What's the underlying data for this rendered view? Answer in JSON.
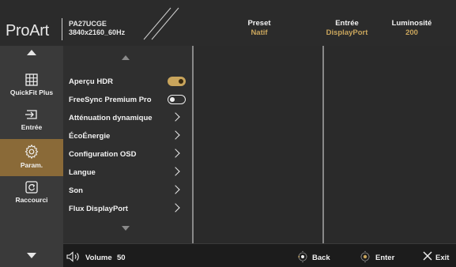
{
  "header": {
    "logo": "ProArt",
    "model": "PA27UCGE",
    "resolution": "3840x2160_60Hz",
    "preset": {
      "label": "Preset",
      "value": "Natif"
    },
    "input": {
      "label": "Entrée",
      "value": "DisplayPort"
    },
    "brightness": {
      "label": "Luminosité",
      "value": "200"
    }
  },
  "nav": {
    "items": [
      {
        "label": "QuickFit Plus",
        "icon": "grid-icon"
      },
      {
        "label": "Entrée",
        "icon": "input-icon"
      },
      {
        "label": "Param.",
        "icon": "gear-icon",
        "active": true
      },
      {
        "label": "Raccourci",
        "icon": "shortcut-icon"
      }
    ]
  },
  "menu": {
    "items": [
      {
        "label": "Aperçu HDR",
        "control": "toggle-on"
      },
      {
        "label": "FreeSync Premium Pro",
        "control": "toggle-off"
      },
      {
        "label": "Atténuation dynamique",
        "control": "chevron"
      },
      {
        "label": "ÉcoÉnergie",
        "control": "chevron"
      },
      {
        "label": "Configuration OSD",
        "control": "chevron"
      },
      {
        "label": "Langue",
        "control": "chevron"
      },
      {
        "label": "Son",
        "control": "chevron"
      },
      {
        "label": "Flux DisplayPort",
        "control": "chevron"
      }
    ]
  },
  "footer": {
    "volume_label": "Volume",
    "volume_value": "50",
    "back_label": "Back",
    "enter_label": "Enter",
    "exit_label": "Exit"
  },
  "colors": {
    "accent": "#c9a55c",
    "active_nav": "#8a6a38",
    "background": "#1e1e1e"
  }
}
